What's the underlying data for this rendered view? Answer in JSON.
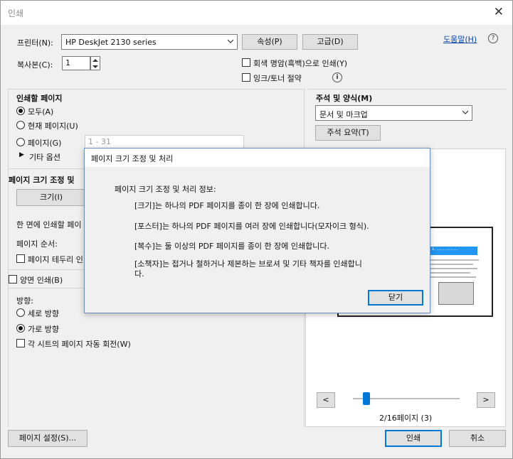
{
  "window": {
    "title": "인쇄"
  },
  "printer": {
    "label": "프린터(N):",
    "value": "HP DeskJet 2130 series",
    "properties_button": "속성(P)",
    "advanced_button": "고급(D)",
    "help_link": "도움말(H)"
  },
  "copies": {
    "label": "복사본(C):",
    "value": "1"
  },
  "options": {
    "grayscale": "회색 명암(흑백)으로 인쇄(Y)",
    "save_ink": "잉크/토너 절약"
  },
  "pages_to_print": {
    "title": "인쇄할 페이지",
    "all": "모두(A)",
    "current": "현재 페이지(U)",
    "pages": "페이지(G)",
    "pages_range": "1 - 31",
    "more_options": "기타 옵션"
  },
  "sizing": {
    "title": "페이지 크기 조정 및",
    "size_button": "크기(I)",
    "pages_per_sheet": "한 면에 인쇄할 페이",
    "page_order": "페이지 순서:",
    "page_border": "페이지 테두리 인",
    "duplex": "양면 인쇄(B)"
  },
  "orientation": {
    "title": "방향:",
    "portrait": "세로 방향",
    "landscape": "가로 방향",
    "auto_rotate": "각 시트의 페이지 자동 회전(W)"
  },
  "comments": {
    "title": "주석 및 양식(M)",
    "value": "문서 및 마크업",
    "summary_button": "주석 요약(T)"
  },
  "preview": {
    "page_header": "1. ...................",
    "page_indicator": "2/16페이지 (3)",
    "progress": 0.1
  },
  "footer": {
    "page_setup": "페이지 설정(S)...",
    "print": "인쇄",
    "cancel": "취소"
  },
  "modal": {
    "title": "페이지 크기 조정 및 처리",
    "heading": "페이지 크기 조정 및 처리 정보:",
    "line1": "[크기]는 하나의 PDF 페이지를 종이 한 장에 인쇄합니다.",
    "line2": "[포스터]는 하나의 PDF 페이지를 여러 장에 인쇄합니다(모자이크 형식).",
    "line3": "[복수]는 둘 이상의 PDF 페이지를 종이 한 장에 인쇄합니다.",
    "line4": "[소책자]는 접거나 철하거나 제본하는 브로셔 및 기타 책자를 인쇄합니다.",
    "close": "닫기"
  },
  "colors": {
    "accent": "#0078d7",
    "link": "#0645ad",
    "preview_banner": "#2196f3"
  }
}
